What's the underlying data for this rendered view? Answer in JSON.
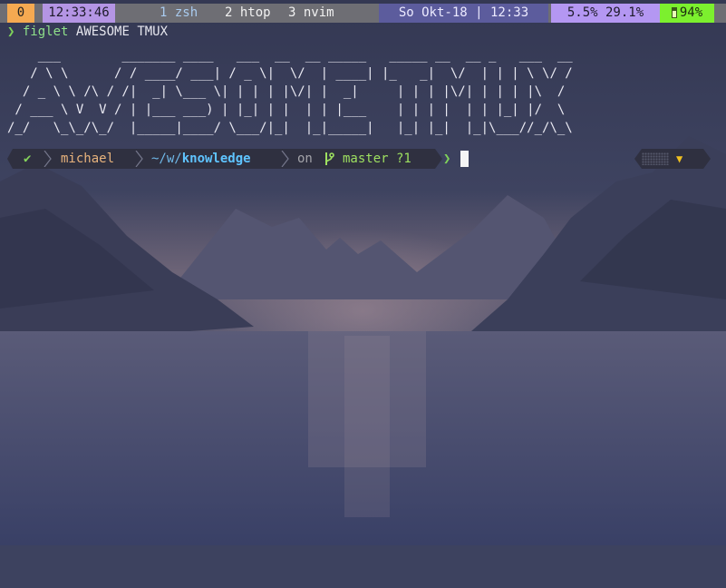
{
  "colors": {
    "session_bg": "#f5a951",
    "clock_bg": "#b495e4",
    "date_bg": "#5c5c9d",
    "cpu_bg": "#b497f2",
    "battery_bg": "#7cf02e",
    "prompt_bg": "#2f3040"
  },
  "statusbar": {
    "session": "0",
    "clock": "12:33:46",
    "windows": [
      {
        "label": "1 zsh"
      },
      {
        "label": "2 htop"
      },
      {
        "label": "3 nvim"
      }
    ],
    "date": "So Okt-18 | 12:33",
    "cpu_mem": "5.5% 29.1%",
    "battery_icon": "battery-icon",
    "battery": "94%"
  },
  "terminal": {
    "prompt_symbol": "❯",
    "command": "figlet",
    "args": "AWESOME TMUX",
    "figlet_output": "    ___        _______ ____   ___  __  __ _____   _____ __  __ _   ___  __\n   / \\ \\      / / ____/ ___| / _ \\|  \\/  | ____| |_   _|  \\/  | | | \\ \\/ /\n  / _ \\ \\ /\\ / /|  _| \\___ \\| | | | |\\/| |  _|     | | | |\\/| | | | |\\  / \n / ___ \\ V  V / | |___ ___) | |_| | |  | | |___    | | | |  | | |_| |/  \\ \n/_/   \\_\\_/\\_/  |_____|____/ \\___/|_|  |_|_____|   |_| |_|  |_|\\___//_/\\_\\"
  },
  "prompt": {
    "status_icon": "check-icon",
    "status_symbol": "✔",
    "user": "michael",
    "dir_prefix": "~/w/",
    "dir_name": "knowledge",
    "on": "on",
    "branch_icon": "git-branch-icon",
    "branch": "master ?1",
    "arrow": "❯",
    "right_icon": "warning-icon",
    "right_symbol": "▼"
  }
}
